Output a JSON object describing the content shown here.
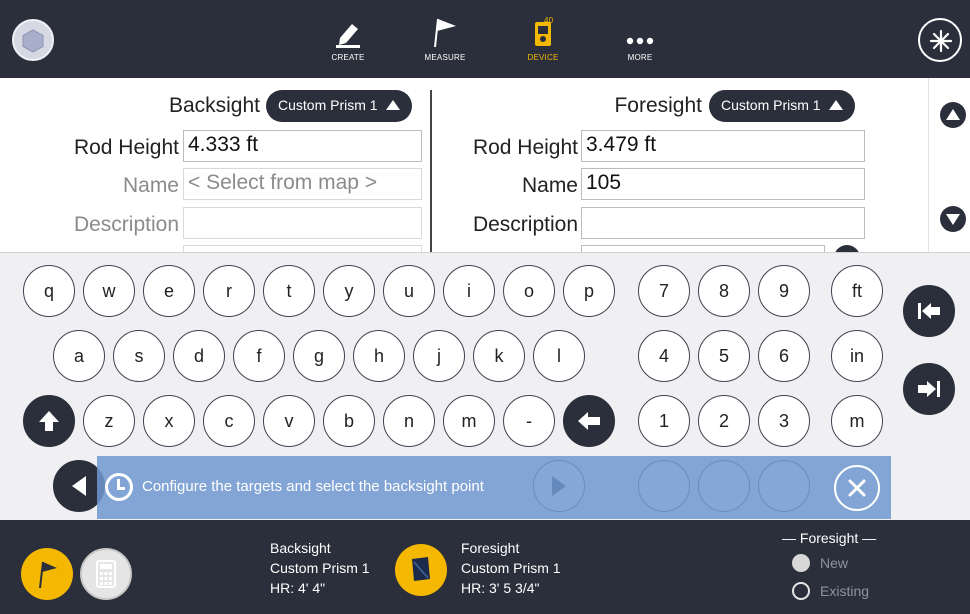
{
  "topbar": {
    "nav": [
      {
        "id": "create",
        "label": "CREATE",
        "icon": "pencil-icon"
      },
      {
        "id": "measure",
        "label": "MEASURE",
        "icon": "flag-icon"
      },
      {
        "id": "device",
        "label": "DEVICE",
        "icon": "total-station-icon",
        "badge": "40"
      },
      {
        "id": "more",
        "label": "MORE",
        "icon": "more-dots-icon"
      }
    ],
    "active_color": "#f5b800",
    "bg_color": "#2b2f3b"
  },
  "backsight": {
    "title": "Backsight",
    "prism": "Custom Prism 1",
    "rod_height_label": "Rod Height",
    "rod_height_value": "4.333 ft",
    "name_label": "Name",
    "name_placeholder": "< Select from map >",
    "description_label": "Description",
    "description_value": ""
  },
  "foresight": {
    "title": "Foresight",
    "prism": "Custom Prism 1",
    "rod_height_label": "Rod Height",
    "rod_height_value": "3.479 ft",
    "name_label": "Name",
    "name_value": "105",
    "description_label": "Description",
    "description_value": ""
  },
  "keyboard": {
    "row1": [
      "q",
      "w",
      "e",
      "r",
      "t",
      "y",
      "u",
      "i",
      "o",
      "p"
    ],
    "row2": [
      "a",
      "s",
      "d",
      "f",
      "g",
      "h",
      "j",
      "k",
      "l"
    ],
    "row3": [
      "z",
      "x",
      "c",
      "v",
      "b",
      "n",
      "m",
      "-"
    ],
    "numpad": [
      [
        "7",
        "8",
        "9",
        "ft"
      ],
      [
        "4",
        "5",
        "6",
        "in"
      ],
      [
        "1",
        "2",
        "3",
        "m"
      ]
    ]
  },
  "toast": {
    "message": "Configure the targets and select the backsight point"
  },
  "bottombar": {
    "backsight_title": "Backsight",
    "backsight_prism": "Custom Prism 1",
    "backsight_hr": "HR:  4' 4\"",
    "foresight_title": "Foresight",
    "foresight_prism": "Custom Prism 1",
    "foresight_hr": "HR:  3' 5 3/4\"",
    "foresight_group_title": "— Foresight —",
    "option_new": "New",
    "option_existing": "Existing"
  }
}
